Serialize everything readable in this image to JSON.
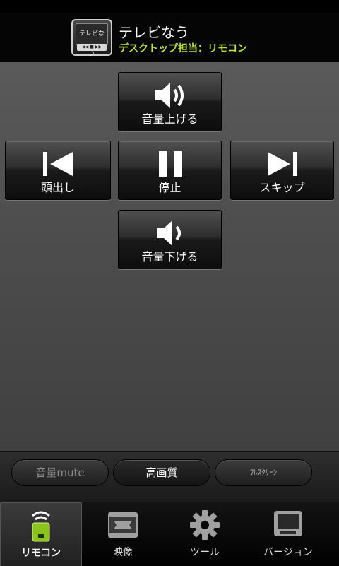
{
  "header": {
    "title": "テレビなう",
    "subtitle": "デスクトップ担当：リモコン",
    "icon": {
      "screen_text": "テレビなう",
      "controls_text": "◀◀  ■  ▶▶"
    }
  },
  "remote": {
    "vol_up": {
      "label": "音量上げる",
      "icon": "volume-up-icon"
    },
    "prev": {
      "label": "頭出し",
      "icon": "skip-back-icon"
    },
    "stop": {
      "label": "停止",
      "icon": "pause-icon"
    },
    "skip": {
      "label": "スキップ",
      "icon": "skip-forward-icon"
    },
    "vol_down": {
      "label": "音量下げる",
      "icon": "volume-down-icon"
    }
  },
  "options": {
    "mute": "音量mute",
    "quality": "高画質",
    "fullscreen": "ﾌﾙｽｸﾘｰﾝ"
  },
  "tabs": [
    {
      "label": "リモコン",
      "icon": "remote-icon",
      "active": true
    },
    {
      "label": "映像",
      "icon": "video-icon",
      "active": false
    },
    {
      "label": "ツール",
      "icon": "gear-icon",
      "active": false
    },
    {
      "label": "バージョン",
      "icon": "monitor-icon",
      "active": false
    }
  ],
  "colors": {
    "accent": "#b8e23a",
    "icon_white": "#ffffff",
    "icon_gray": "#9a9a9a"
  }
}
